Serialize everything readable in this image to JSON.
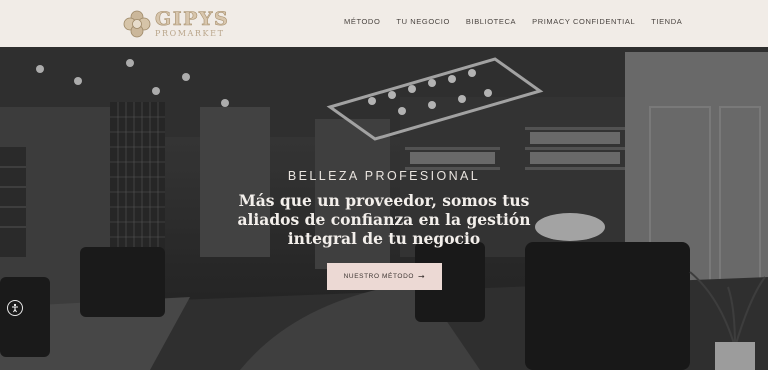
{
  "header": {
    "logo": {
      "name": "GIPYS",
      "sub": "PROMARKET"
    },
    "nav": [
      {
        "label": "Método"
      },
      {
        "label": "Tu negocio"
      },
      {
        "label": "Biblioteca"
      },
      {
        "label": "Primacy Confidential"
      },
      {
        "label": "Tienda"
      }
    ]
  },
  "hero": {
    "eyebrow": "BELLEZA PROFESIONAL",
    "headline": "Más que un proveedor, somos tus aliados de confianza en la gestión integral de tu negocio",
    "cta": {
      "label": "NUESTRO MÉTODO",
      "arrow": "➞"
    }
  },
  "colors": {
    "header_bg": "#f1ece7",
    "cta_bg": "#ecd9d4",
    "logo_gold": "#d8c6ad"
  },
  "icons": {
    "accessibility": "accessibility-icon",
    "arrow": "arrow-right-icon"
  }
}
